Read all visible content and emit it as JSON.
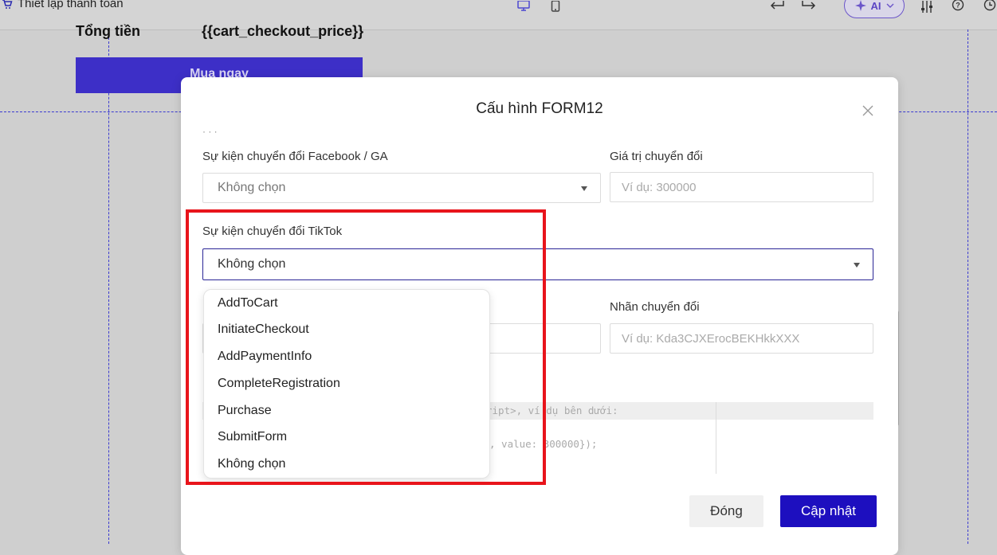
{
  "editor": {
    "page_title": "Thiết lập thanh toán",
    "ai_label": "AI",
    "total_label": "Tổng tiền",
    "total_value": "{{cart_checkout_price}}",
    "buy_button": "Mua ngay"
  },
  "modal": {
    "title": "Cấu hình FORM12",
    "partial_label_top": "· · ·",
    "fb_event_label": "Sự kiện chuyển đổi Facebook / GA",
    "fb_event_value": "Không chọn",
    "conversion_value_label": "Giá trị chuyển đổi",
    "conversion_value_placeholder": "Ví dụ: 300000",
    "tiktok_event_label": "Sự kiện chuyển đổi TikTok",
    "tiktok_event_value": "Không chọn",
    "conversion_label_label": "Nhãn chuyển đổi",
    "conversion_label_placeholder": "Ví dụ: Kda3CJXErocBEKHkkXXX",
    "code_line1": "ript>, ví dụ bên dưới:",
    "code_line2": ", value: 300000});",
    "close_button": "Đóng",
    "update_button": "Cập nhật"
  },
  "dropdown": {
    "options": [
      "AddToCart",
      "InitiateCheckout",
      "AddPaymentInfo",
      "CompleteRegistration",
      "Purchase",
      "SubmitForm",
      "Không chọn"
    ]
  },
  "colors": {
    "accent": "#1d0fbf",
    "highlight": "#e8141b",
    "buy_button": "#3d2fc7"
  }
}
